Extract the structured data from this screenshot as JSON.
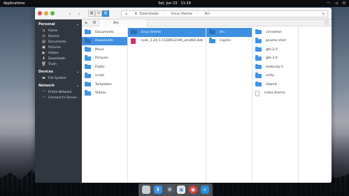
{
  "top_panel": {
    "applications": "Applications",
    "day": "Sat, Jun 23",
    "time": "11:29"
  },
  "window": {
    "pathbar": [
      "Downloads",
      "linux theme",
      "Arc"
    ],
    "tabs": [
      {
        "label": "Arc"
      }
    ]
  },
  "sidebar": {
    "sections": [
      {
        "header": "Personal",
        "items": [
          {
            "label": "Home",
            "icon": "home-icon"
          },
          {
            "label": "Recent",
            "icon": "recent-icon"
          },
          {
            "label": "Documents",
            "icon": "documents-icon"
          },
          {
            "label": "Pictures",
            "icon": "pictures-icon"
          },
          {
            "label": "Videos",
            "icon": "videos-icon"
          },
          {
            "label": "Downloads",
            "icon": "downloads-icon"
          },
          {
            "label": "Trash",
            "icon": "trash-icon"
          }
        ]
      },
      {
        "header": "Devices",
        "items": [
          {
            "label": "File System",
            "icon": "drive-icon"
          }
        ]
      },
      {
        "header": "Network",
        "items": [
          {
            "label": "Entire Network",
            "icon": "network-icon"
          },
          {
            "label": "Connect to Server...",
            "icon": "server-icon"
          }
        ]
      }
    ]
  },
  "columns": {
    "col1": [
      "Documents",
      "Downloads",
      "Music",
      "Pictures",
      "Public",
      "script",
      "Templates",
      "Videos"
    ],
    "col2": [
      "linux theme",
      "code_1.24.1-1528912196_amd64.deb"
    ],
    "col3": [
      "Arc",
      "Capitis"
    ],
    "col4": [
      "cinnamon",
      "gnome-shell",
      "gtk-2.0",
      "gtk-3.0",
      "metacity-1",
      "unity",
      "xfwm4",
      "index.theme"
    ]
  },
  "dock": [
    {
      "name": "trash-dock-icon",
      "color": "#c9ced6"
    },
    {
      "name": "downloads-dock-icon",
      "color": "#3d93e6"
    },
    {
      "name": "system-settings-dock-icon",
      "color": "#505862"
    },
    {
      "name": "files-dock-icon",
      "color": "#e8e8e8"
    },
    {
      "name": "chrome-dock-icon",
      "color": "#d9453a"
    },
    {
      "name": "vscode-dock-icon",
      "color": "#2a8fd6"
    }
  ]
}
